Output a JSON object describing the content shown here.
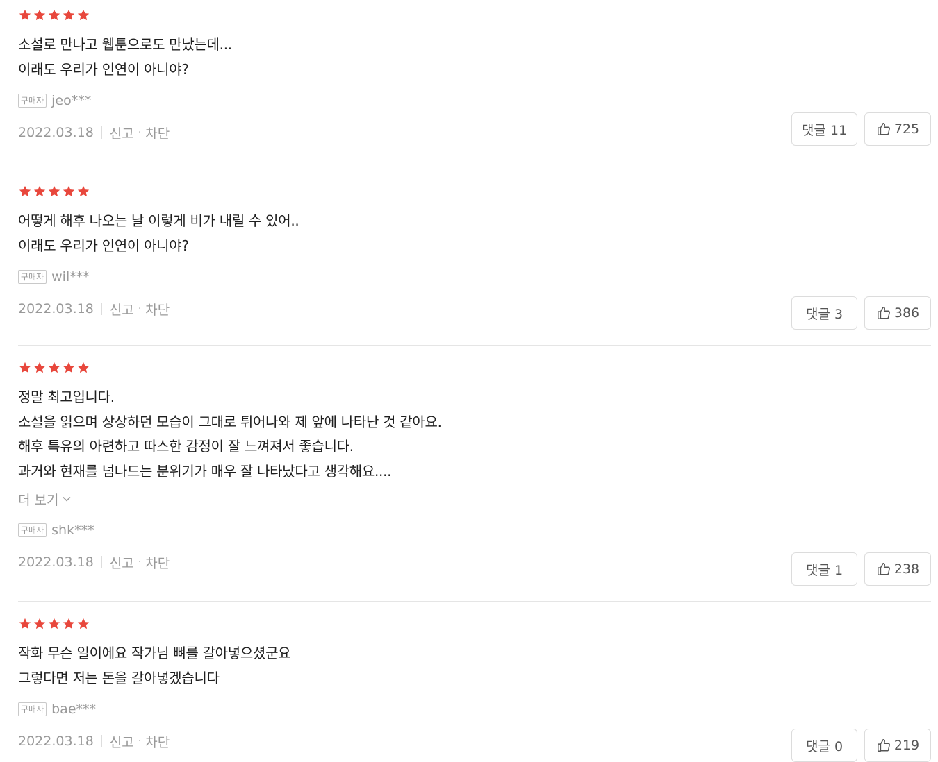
{
  "colors": {
    "star": "#e8473c",
    "muted": "#999999",
    "border": "#dcdcdc"
  },
  "icons": {
    "star": "star-icon",
    "like": "thumbs-up-icon",
    "chevron": "chevron-down-icon"
  },
  "labels": {
    "buyer_badge": "구매자",
    "report": "신고",
    "block": "차단",
    "comment_prefix": "댓글",
    "more": "더 보기"
  },
  "reviews": [
    {
      "rating": 5,
      "lines": [
        "소설로 만나고 웹툰으로도 만났는데...",
        "이래도 우리가 인연이 아니야?"
      ],
      "user": "jeo***",
      "date": "2022.03.18",
      "comments_label": "댓글 11",
      "likes": "725"
    },
    {
      "rating": 5,
      "lines": [
        "어떻게 해후 나오는 날 이렇게 비가 내릴 수 있어..",
        "이래도 우리가 인연이 아니야?"
      ],
      "user": "wil***",
      "date": "2022.03.18",
      "comments_label": "댓글 3",
      "likes": "386"
    },
    {
      "rating": 5,
      "lines": [
        "정말 최고입니다.",
        "소설을 읽으며 상상하던 모습이 그대로 튀어나와 제 앞에 나타난 것 같아요.",
        "해후 특유의 아련하고 따스한 감정이 잘 느껴져서 좋습니다.",
        "과거와 현재를 넘나드는 분위기가 매우 잘 나타났다고 생각해요...."
      ],
      "user": "shk***",
      "date": "2022.03.18",
      "comments_label": "댓글 1",
      "likes": "238"
    },
    {
      "rating": 5,
      "lines": [
        "작화 무슨 일이에요 작가님 뼈를 갈아넣으셨군요",
        "그렇다면 저는 돈을 갈아넣겠습니다"
      ],
      "user": "bae***",
      "date": "2022.03.18",
      "comments_label": "댓글 0",
      "likes": "219"
    }
  ]
}
